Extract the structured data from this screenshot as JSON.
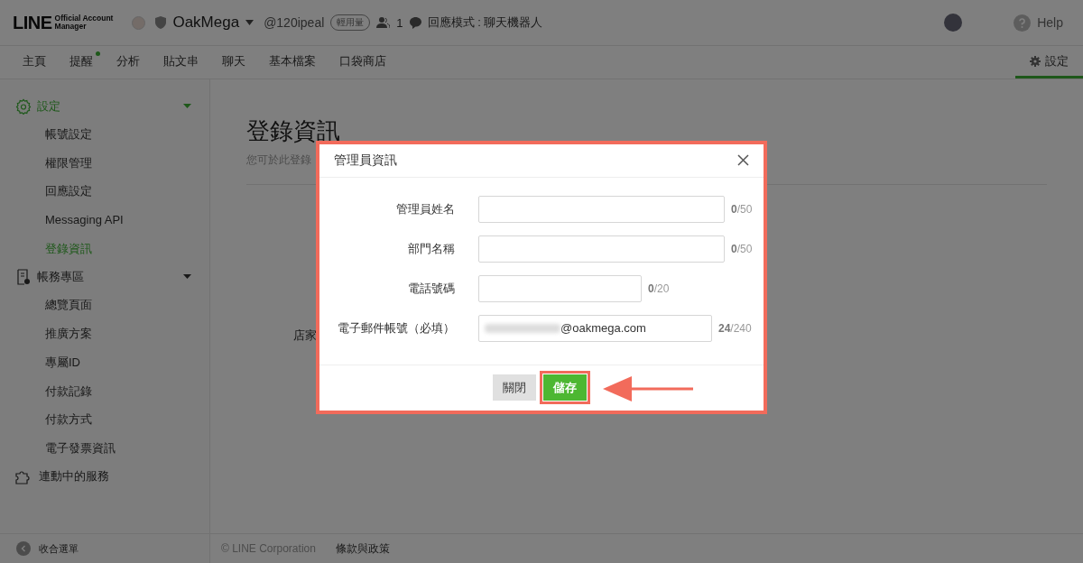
{
  "header": {
    "logo": {
      "wordmark": "LINE",
      "subtitle_lines": [
        "Official Account",
        "Manager"
      ]
    },
    "account_name": "OakMega",
    "account_id": "@120ipeal",
    "plan_badge": "輕用量",
    "friends_count": "1",
    "response_mode": "回應模式 : 聊天機器人",
    "help": "Help"
  },
  "nav": {
    "tabs": [
      {
        "label": "主頁",
        "selected": false,
        "notification": false
      },
      {
        "label": "提醒",
        "selected": false,
        "notification": true
      },
      {
        "label": "分析",
        "selected": false,
        "notification": false
      },
      {
        "label": "貼文串",
        "selected": false,
        "notification": false
      },
      {
        "label": "聊天",
        "selected": false,
        "notification": false
      },
      {
        "label": "基本檔案",
        "selected": false,
        "notification": false
      },
      {
        "label": "口袋商店",
        "selected": false,
        "notification": false
      }
    ],
    "settings_tab": {
      "label": "設定",
      "selected": true
    }
  },
  "sidebar": {
    "sections": [
      {
        "label": "設定",
        "kind": "group",
        "selected": true,
        "children": [
          {
            "label": "帳號設定",
            "selected": false
          },
          {
            "label": "權限管理",
            "selected": false
          },
          {
            "label": "回應設定",
            "selected": false
          },
          {
            "label": "Messaging API",
            "selected": false
          },
          {
            "label": "登錄資訊",
            "selected": true
          }
        ]
      },
      {
        "label": "帳務專區",
        "kind": "group",
        "selected": false,
        "children": [
          {
            "label": "總覽頁面",
            "selected": false
          },
          {
            "label": "推廣方案",
            "selected": false
          },
          {
            "label": "專屬ID",
            "selected": false
          },
          {
            "label": "付款記錄",
            "selected": false
          },
          {
            "label": "付款方式",
            "selected": false
          },
          {
            "label": "電子發票資訊",
            "selected": false
          }
        ]
      },
      {
        "label": "連動中的服務",
        "kind": "link",
        "selected": false
      }
    ],
    "collapse": "收合選單"
  },
  "page": {
    "title": "登錄資訊",
    "description": "您可於此登錄",
    "store_label": "店家"
  },
  "footer": {
    "copyright": "© LINE Corporation",
    "terms": "條款與政策"
  },
  "modal": {
    "title": "管理員資訊",
    "highlighted": true,
    "fields": [
      {
        "label": "管理員姓名",
        "counter": "**0**/50",
        "redacted": false
      },
      {
        "label": "部門名稱",
        "counter": "**0**/50",
        "redacted": false
      },
      {
        "label": "電話號碼",
        "counter": "**0**/20",
        "redacted": false
      },
      {
        "label": "電子郵件帳號（必填）",
        "value": "@oakmega.com",
        "counter": "**24**/240",
        "redacted": true
      }
    ],
    "buttons": [
      {
        "label": "關閉",
        "kind": "secondary",
        "highlighted": false
      },
      {
        "label": "儲存",
        "kind": "primary",
        "highlighted": true
      }
    ]
  }
}
